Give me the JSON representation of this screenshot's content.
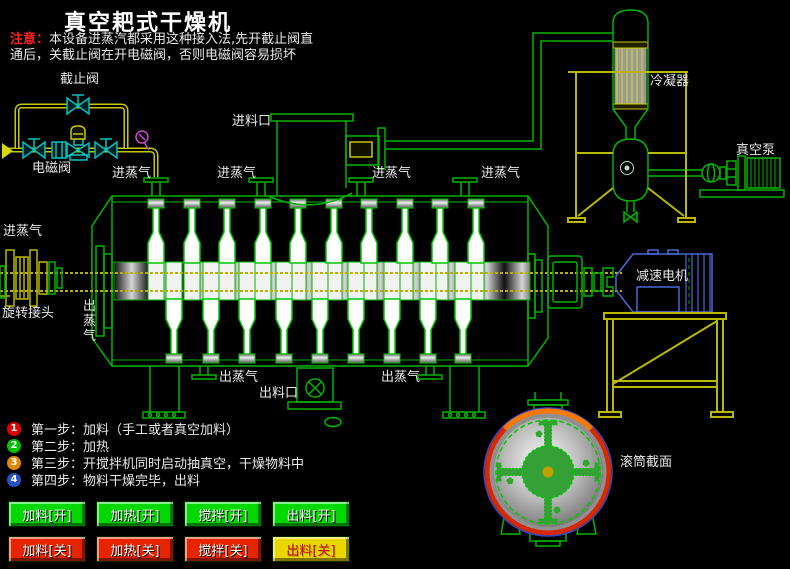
{
  "title": "真空耙式干燥机",
  "note": {
    "label": "注意：",
    "line1": "本设备进蒸汽都采用这种接入法,先开截止阀直",
    "line2": "通后，关截止阀在开电磁阀，否则电磁阀容易损坏"
  },
  "labels": {
    "stop_valve": "截止阀",
    "solenoid_valve": "电磁阀",
    "feed_inlet": "进料口",
    "steam_in": "进蒸气",
    "steam_out": "出蒸气",
    "rotary_joint": "旋转接头",
    "discharge_outlet": "出料口",
    "condenser": "冷凝器",
    "vacuum_pump": "真空泵",
    "gear_motor": "减速电机",
    "drum_section": "滚筒截面"
  },
  "steps": [
    {
      "num": "1",
      "color": "#e00000",
      "text": "第一步：加料（手工或者真空加料）"
    },
    {
      "num": "2",
      "color": "#00c000",
      "text": "第二步：加热"
    },
    {
      "num": "3",
      "color": "#e08800",
      "text": "第三步：开搅拌机同时启动抽真空，干燥物料中"
    },
    {
      "num": "4",
      "color": "#2850c8",
      "text": "第四步：物料干燥完毕，出料"
    }
  ],
  "buttons": {
    "feed_on": "加料[开]",
    "heat_on": "加热[开]",
    "stir_on": "搅拌[开]",
    "discharge_on": "出料[开]",
    "feed_off": "加料[关]",
    "heat_off": "加热[关]",
    "stir_off": "搅拌[关]",
    "discharge_off": "出料[关]"
  },
  "colors": {
    "pipe_green": "#00b400",
    "pipe_yellow": "#c8c800",
    "valve_cyan": "#00c0c0",
    "gauge_magenta": "#c050c0",
    "motor_blue": "#4868d8",
    "drum_ring_red": "#d82800",
    "btn_on_green": "#00d800",
    "btn_off_red": "#e82400",
    "btn_discharge_off_yellow": "#e8d800"
  }
}
